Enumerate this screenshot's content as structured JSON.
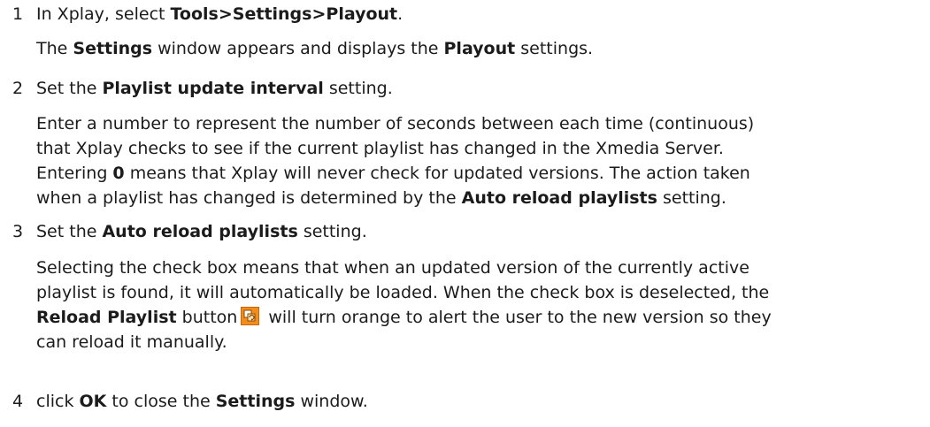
{
  "steps": [
    {
      "number": "1",
      "instruction": {
        "t1": "In Xplay, select ",
        "b1": "Tools>Settings>Playout",
        "t2": "."
      },
      "result": {
        "t1": "The ",
        "b1": "Settings",
        "t2": " window appears and displays the ",
        "b2": "Playout",
        "t3": " settings."
      }
    },
    {
      "number": "2",
      "instruction": {
        "t1": "Set the ",
        "b1": "Playlist update interval",
        "t2": " setting."
      },
      "detail": {
        "l1": "Enter a number to represent the number of seconds between each time (continuous)",
        "l2": "that Xplay checks to see if the current playlist has changed in the Xmedia Server.",
        "l3_t1": "Entering ",
        "l3_b1": "0",
        "l3_t2": " means that Xplay will never check for updated versions. The action taken",
        "l4_t1": "when a playlist has changed is determined by the ",
        "l4_b1": "Auto reload playlists",
        "l4_t2": " setting."
      }
    },
    {
      "number": "3",
      "instruction": {
        "t1": "Set the ",
        "b1": "Auto reload playlists",
        "t2": " setting."
      },
      "detail": {
        "l1": "Selecting the check box means that when an updated version of the currently active",
        "l2": "playlist is found, it will automatically be loaded. When the check box is deselected, the",
        "l3_b1": "Reload Playlist",
        "l3_t1": " button",
        "l3_t2": " will turn orange to alert the user to the new version so they",
        "l4": "can reload it manually."
      }
    },
    {
      "number": "4",
      "instruction": {
        "t1": "click ",
        "b1": "OK",
        "t2": " to close the ",
        "b2": "Settings",
        "t3": " window."
      }
    }
  ],
  "icons": {
    "reload_playlist": "reload-playlist-icon",
    "reload_color": "#f28c1a"
  }
}
